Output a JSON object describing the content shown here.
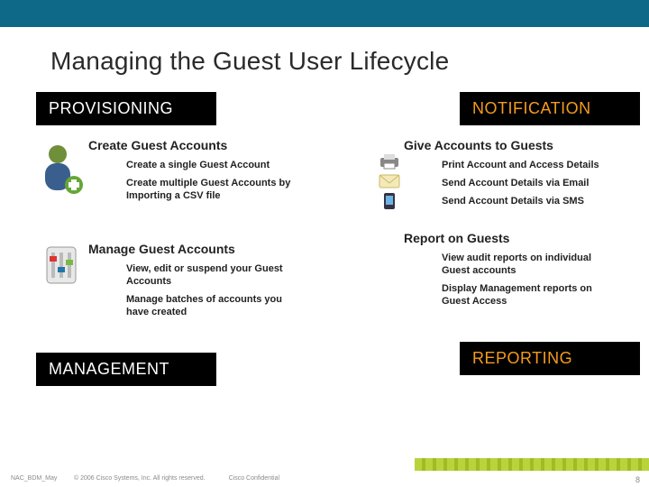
{
  "title": "Managing the Guest User Lifecycle",
  "tl": {
    "pill": "PROVISIONING",
    "heading": "Create Guest Accounts",
    "items": [
      "Create a single Guest Account",
      "Create multiple Guest Accounts by Importing a CSV file"
    ]
  },
  "tr": {
    "pill": "NOTIFICATION",
    "heading": "Give Accounts to Guests",
    "items": [
      "Print Account and Access Details",
      "Send Account Details via Email",
      "Send Account Details via SMS"
    ]
  },
  "bl": {
    "pill": "MANAGEMENT",
    "heading": "Manage Guest Accounts",
    "items": [
      "View, edit or suspend your Guest Accounts",
      "Manage batches of accounts you have created"
    ]
  },
  "br": {
    "pill": "REPORTING",
    "heading": "Report on Guests",
    "items": [
      "View audit reports on individual Guest accounts",
      "Display Management reports on Guest Access"
    ]
  },
  "footer": {
    "a": "NAC_BDM_May",
    "b": "© 2006 Cisco Systems, Inc. All rights reserved.",
    "c": "Cisco Confidential",
    "page": "8"
  }
}
